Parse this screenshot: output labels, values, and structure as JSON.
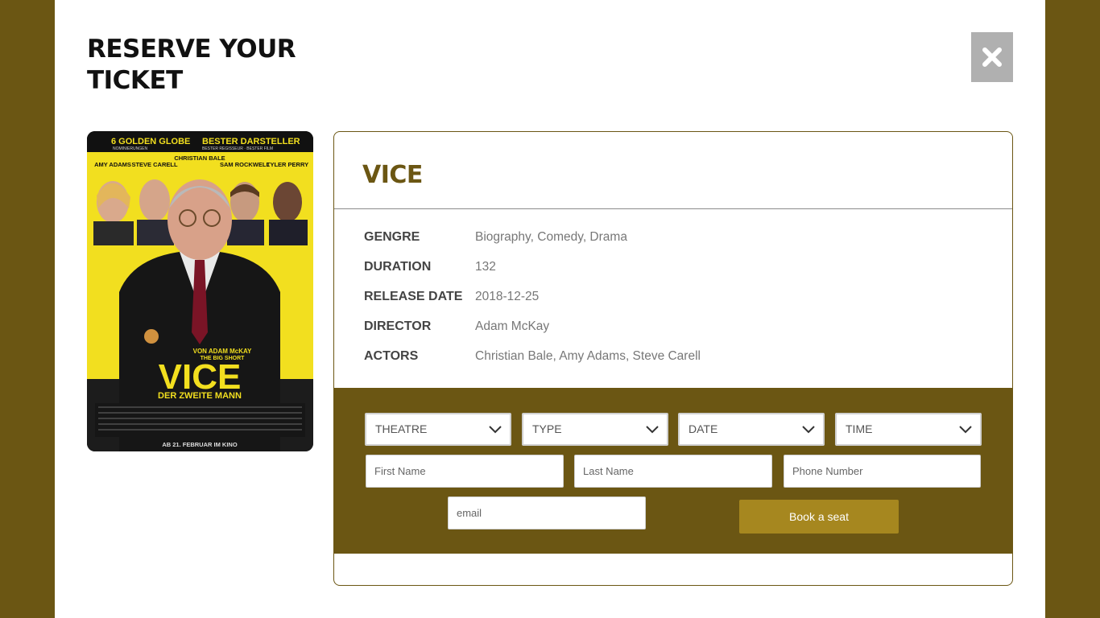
{
  "modal": {
    "title": "RESERVE YOUR TICKET",
    "close_icon": "close-icon"
  },
  "poster": {
    "top_line_left": "6 GOLDEN GLOBE",
    "top_line_left_sub": "NOMINIERUNGEN",
    "top_line_right": "BESTER DARSTELLER",
    "top_line_right_sub": "BESTER REGISSEUR · BESTER FILM",
    "cast": [
      {
        "name": "AMY ADAMS"
      },
      {
        "name": "STEVE CARELL"
      },
      {
        "name": "CHRISTIAN BALE"
      },
      {
        "name": "SAM ROCKWELL"
      },
      {
        "name": "TYLER PERRY"
      }
    ],
    "director_line": "VON ADAM McKAY",
    "director_sub": "THE BIG SHORT",
    "title": "VICE",
    "subtitle": "DER ZWEITE MANN",
    "release": "AB 21. FEBRUAR IM KINO"
  },
  "movie": {
    "title": "VICE",
    "details": [
      {
        "label": "GENGRE",
        "value": "Biography, Comedy, Drama"
      },
      {
        "label": "DURATION",
        "value": "132"
      },
      {
        "label": "RELEASE DATE",
        "value": "2018-12-25"
      },
      {
        "label": "DIRECTOR",
        "value": "Adam McKay"
      },
      {
        "label": "ACTORS",
        "value": "Christian Bale, Amy Adams, Steve Carell"
      }
    ]
  },
  "booking": {
    "selects": [
      {
        "label": "THEATRE"
      },
      {
        "label": "TYPE"
      },
      {
        "label": "DATE"
      },
      {
        "label": "TIME"
      }
    ],
    "first_name_placeholder": "First Name",
    "last_name_placeholder": "Last Name",
    "phone_placeholder": "Phone Number",
    "email_placeholder": "email",
    "submit_label": "Book a seat"
  },
  "colors": {
    "brand": "#6b5613",
    "button": "#a6871f",
    "close_bg": "#b0b0b0",
    "poster_yellow": "#f2df1f"
  }
}
